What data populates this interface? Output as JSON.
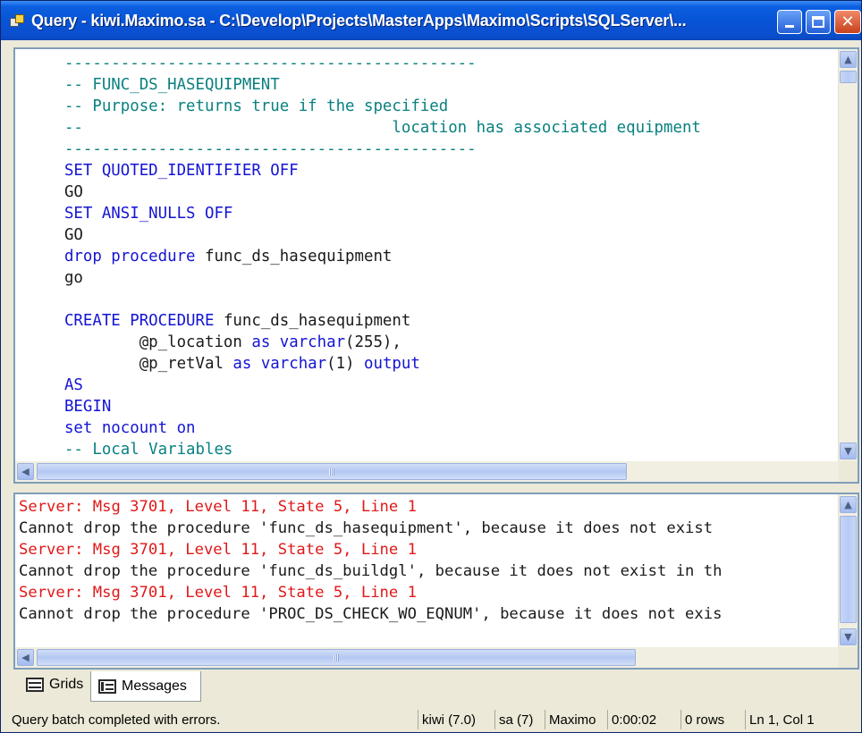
{
  "window": {
    "title": "Query - kiwi.Maximo.sa - C:\\Develop\\Projects\\MasterApps\\Maximo\\Scripts\\SQLServer\\...",
    "icon": "query-analyzer-icon",
    "buttons": {
      "minimize": "minimize-icon",
      "maximize": "maximize-icon",
      "close": "close-icon",
      "close_glyph": "✕"
    }
  },
  "colors": {
    "comment": "#0a8080",
    "keyword": "#1414d4",
    "plain": "#1a1a1a",
    "error": "#e01818",
    "titlebar": "#0854d6"
  },
  "editor": {
    "lines": [
      [
        {
          "t": "c",
          "s": "  --------------------------------------------"
        }
      ],
      [
        {
          "t": "c",
          "s": "  -- FUNC_DS_HASEQUIPMENT"
        }
      ],
      [
        {
          "t": "c",
          "s": "  -- Purpose: returns true if the specified"
        }
      ],
      [
        {
          "t": "c",
          "s": "  --                                 location has associated equipment"
        }
      ],
      [
        {
          "t": "c",
          "s": "  --------------------------------------------"
        }
      ],
      [
        {
          "t": "k",
          "s": "  SET QUOTED_IDENTIFIER OFF"
        }
      ],
      [
        {
          "t": "p",
          "s": "  GO"
        }
      ],
      [
        {
          "t": "k",
          "s": "  SET ANSI_NULLS OFF"
        }
      ],
      [
        {
          "t": "p",
          "s": "  GO"
        }
      ],
      [
        {
          "t": "k",
          "s": "  drop procedure "
        },
        {
          "t": "p",
          "s": "func_ds_hasequipment"
        }
      ],
      [
        {
          "t": "p",
          "s": "  go"
        }
      ],
      [
        {
          "t": "p",
          "s": ""
        }
      ],
      [
        {
          "t": "k",
          "s": "  CREATE PROCEDURE "
        },
        {
          "t": "p",
          "s": "func_ds_hasequipment"
        }
      ],
      [
        {
          "t": "p",
          "s": "          @p_location "
        },
        {
          "t": "k",
          "s": "as varchar"
        },
        {
          "t": "p",
          "s": "(255),"
        }
      ],
      [
        {
          "t": "p",
          "s": "          @p_retVal "
        },
        {
          "t": "k",
          "s": "as varchar"
        },
        {
          "t": "p",
          "s": "(1) "
        },
        {
          "t": "k",
          "s": "output"
        }
      ],
      [
        {
          "t": "k",
          "s": "  AS"
        }
      ],
      [
        {
          "t": "k",
          "s": "  BEGIN"
        }
      ],
      [
        {
          "t": "k",
          "s": "  set nocount on"
        }
      ],
      [
        {
          "t": "c",
          "s": "  -- Local Variables"
        }
      ]
    ]
  },
  "results": {
    "messages": [
      {
        "type": "error",
        "text": "Server: Msg 3701, Level 11, State 5, Line 1"
      },
      {
        "type": "text",
        "text": "Cannot drop the procedure 'func_ds_hasequipment', because it does not exist"
      },
      {
        "type": "error",
        "text": "Server: Msg 3701, Level 11, State 5, Line 1"
      },
      {
        "type": "text",
        "text": "Cannot drop the procedure 'func_ds_buildgl', because it does not exist in th"
      },
      {
        "type": "error",
        "text": "Server: Msg 3701, Level 11, State 5, Line 1"
      },
      {
        "type": "text",
        "text": "Cannot drop the procedure 'PROC_DS_CHECK_WO_EQNUM', because it does not exis"
      }
    ]
  },
  "tabs": {
    "grids": {
      "label": "Grids",
      "icon": "grid-icon"
    },
    "messages": {
      "label": "Messages",
      "icon": "messages-icon",
      "active": true
    }
  },
  "statusbar": {
    "status": "Query batch completed with errors.",
    "server": "kiwi (7.0)",
    "user": "sa (7)",
    "database": "Maximo",
    "elapsed": "0:00:02",
    "rows": "0 rows",
    "position": "Ln 1, Col 1"
  },
  "scroll_glyphs": {
    "up": "▲",
    "down": "▼",
    "left": "◀",
    "right": "▶"
  }
}
